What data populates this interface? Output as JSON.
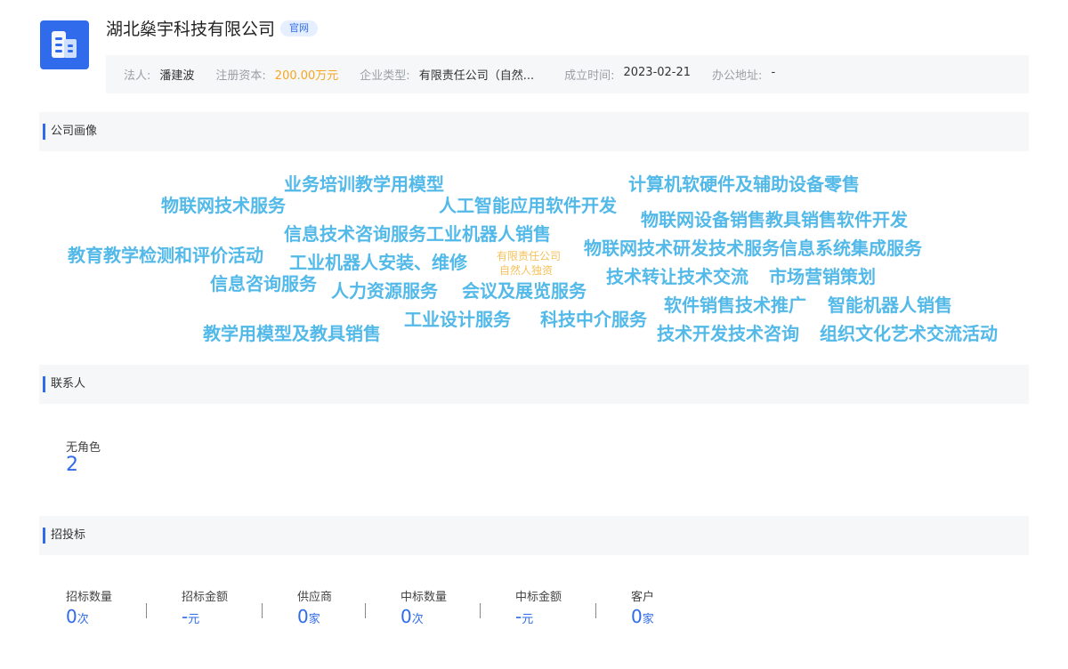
{
  "company": {
    "name": "湖北燊宇科技有限公司",
    "badge": "官网",
    "logo_icon": "building-icon",
    "brand_color": "#2f6bea"
  },
  "info": {
    "legal_rep_label": "法人:",
    "legal_rep": "潘建波",
    "capital_label": "注册资本:",
    "capital": "200.00万元",
    "type_label": "企业类型:",
    "type": "有限责任公司（自然...",
    "founded_label": "成立时间:",
    "founded": "2023-02-21",
    "address_label": "办公地址:",
    "address": "-"
  },
  "sections": {
    "portrait": "公司画像",
    "contacts": "联系人",
    "bidding": "招投标"
  },
  "word_cloud": [
    "业务培训教学用模型",
    "计算机软硬件及辅助设备零售",
    "物联网技术服务",
    "人工智能应用软件开发",
    "物联网设备销售教具销售软件开发",
    "信息技术咨询服务工业机器人销售",
    "物联网技术研发技术服务信息系统集成服务",
    "教育教学检测和评价活动",
    "工业机器人安装、维修",
    "有限责任公司",
    "自然人独资",
    "技术转让技术交流",
    "市场营销策划",
    "信息咨询服务",
    "人力资源服务",
    "会议及展览服务",
    "软件销售技术推广",
    "智能机器人销售",
    "工业设计服务",
    "科技中介服务",
    "教学用模型及教具销售",
    "技术开发技术咨询",
    "组织文化艺术交流活动"
  ],
  "contacts": {
    "role": "无角色",
    "count": "2"
  },
  "bidding": [
    {
      "label": "招标数量",
      "value": "0",
      "unit": "次"
    },
    {
      "label": "招标金额",
      "value": "-",
      "unit": "元"
    },
    {
      "label": "供应商",
      "value": "0",
      "unit": "家"
    },
    {
      "label": "中标数量",
      "value": "0",
      "unit": "次"
    },
    {
      "label": "中标金额",
      "value": "-",
      "unit": "元"
    },
    {
      "label": "客户",
      "value": "0",
      "unit": "家"
    }
  ]
}
